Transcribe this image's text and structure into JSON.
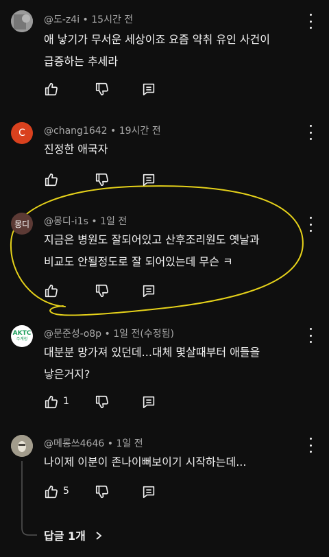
{
  "comments": [
    {
      "author": "@도-z4i",
      "time": "15시간 전",
      "text_lines": [
        "애 낳기가 무서운 세상이죠 요즘 약취 유인 사건이",
        "급증하는 추세라"
      ],
      "like_count": "",
      "avatar": {
        "kind": "photo",
        "text": "",
        "color": "#8a8a8a"
      }
    },
    {
      "author": "@chang1642",
      "time": "19시간 전",
      "text_lines": [
        "진정한 애국자"
      ],
      "like_count": "",
      "avatar": {
        "kind": "letter",
        "text": "C",
        "color": "#d9411e"
      }
    },
    {
      "author": "@몽디-i1s",
      "time": "1일 전",
      "text_lines": [
        "지금은 병원도 잘되어있고 산후조리원도 옛날과",
        "비교도 안될정도로 잘 되어있는데 무슨 ㅋ"
      ],
      "like_count": "",
      "avatar": {
        "kind": "letter",
        "text": "몽디",
        "color": "#5c3a35"
      }
    },
    {
      "author": "@문준성-o8p",
      "time": "1일 전(수정됨)",
      "text_lines": [
        "대분분 망가져 있던데...대체 몇살때부터 애들을",
        "낳은거지?"
      ],
      "like_count": "1",
      "avatar": {
        "kind": "logo",
        "text": "AKTC",
        "subtext": "주계청",
        "color": "#ffffff"
      }
    },
    {
      "author": "@메롱쓰4646",
      "time": "1일 전",
      "text_lines": [
        "나이제 이분이 존나이뻐보이기 시작하는데..."
      ],
      "like_count": "5",
      "avatar": {
        "kind": "photo",
        "text": "",
        "color": "#9b9585"
      }
    }
  ],
  "replies_label": "답글 1개",
  "colors": {
    "background": "#0f0f0f",
    "text": "#f1f1f1",
    "meta": "#aaaaaa",
    "highlight": "#e6d21a"
  },
  "icons": [
    "like-icon",
    "dislike-icon",
    "reply-icon",
    "more-vert-icon",
    "chevron-right-icon"
  ]
}
